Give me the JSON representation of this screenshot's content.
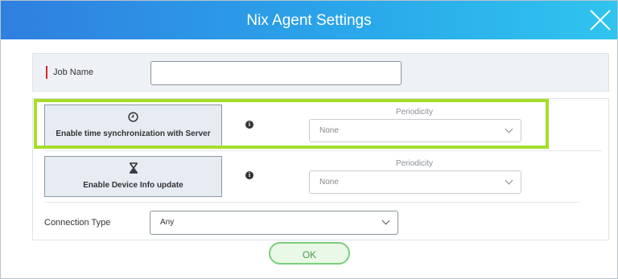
{
  "dialog": {
    "title": "Nix Agent Settings"
  },
  "job": {
    "label": "Job Name",
    "value": ""
  },
  "time_sync": {
    "button_label": "Enable time synchronization with Server",
    "icon": "clock-icon",
    "periodicity_label": "Periodicity",
    "periodicity_value": "None"
  },
  "device_info": {
    "button_label": "Enable Device Info update",
    "icon": "hourglass-icon",
    "periodicity_label": "Periodicity",
    "periodicity_value": "None"
  },
  "connection": {
    "label": "Connection Type",
    "value": "Any"
  },
  "footer": {
    "ok_label": "OK"
  },
  "colors": {
    "header_start": "#2f7fe0",
    "header_end": "#30c4ee",
    "highlight": "#a6dd2b",
    "ok_border": "#7bd07a",
    "required_marker": "#d9262f"
  }
}
